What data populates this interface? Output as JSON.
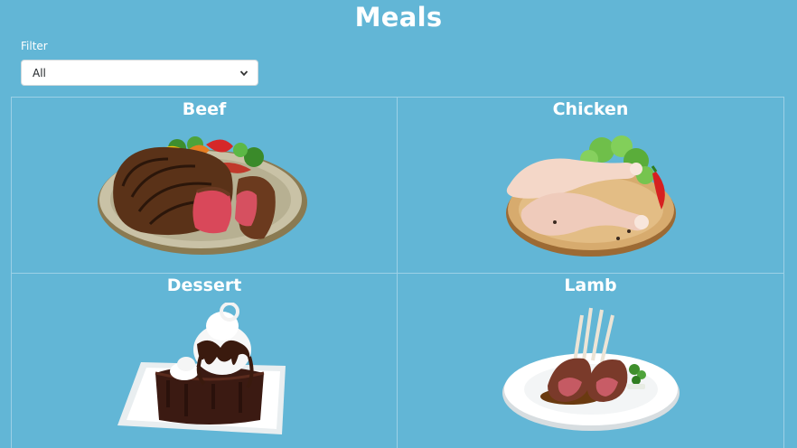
{
  "header": {
    "title": "Meals"
  },
  "filter": {
    "label": "Filter",
    "selected": "All"
  },
  "categories": [
    {
      "name": "Beef",
      "image": "steak-plate-image"
    },
    {
      "name": "Chicken",
      "image": "raw-chicken-board-image"
    },
    {
      "name": "Dessert",
      "image": "brownie-sundae-image"
    },
    {
      "name": "Lamb",
      "image": "lamb-chops-plate-image"
    }
  ],
  "colors": {
    "background": "#62b6d6",
    "grid_line": "#9cd0e6",
    "text": "#ffffff"
  }
}
